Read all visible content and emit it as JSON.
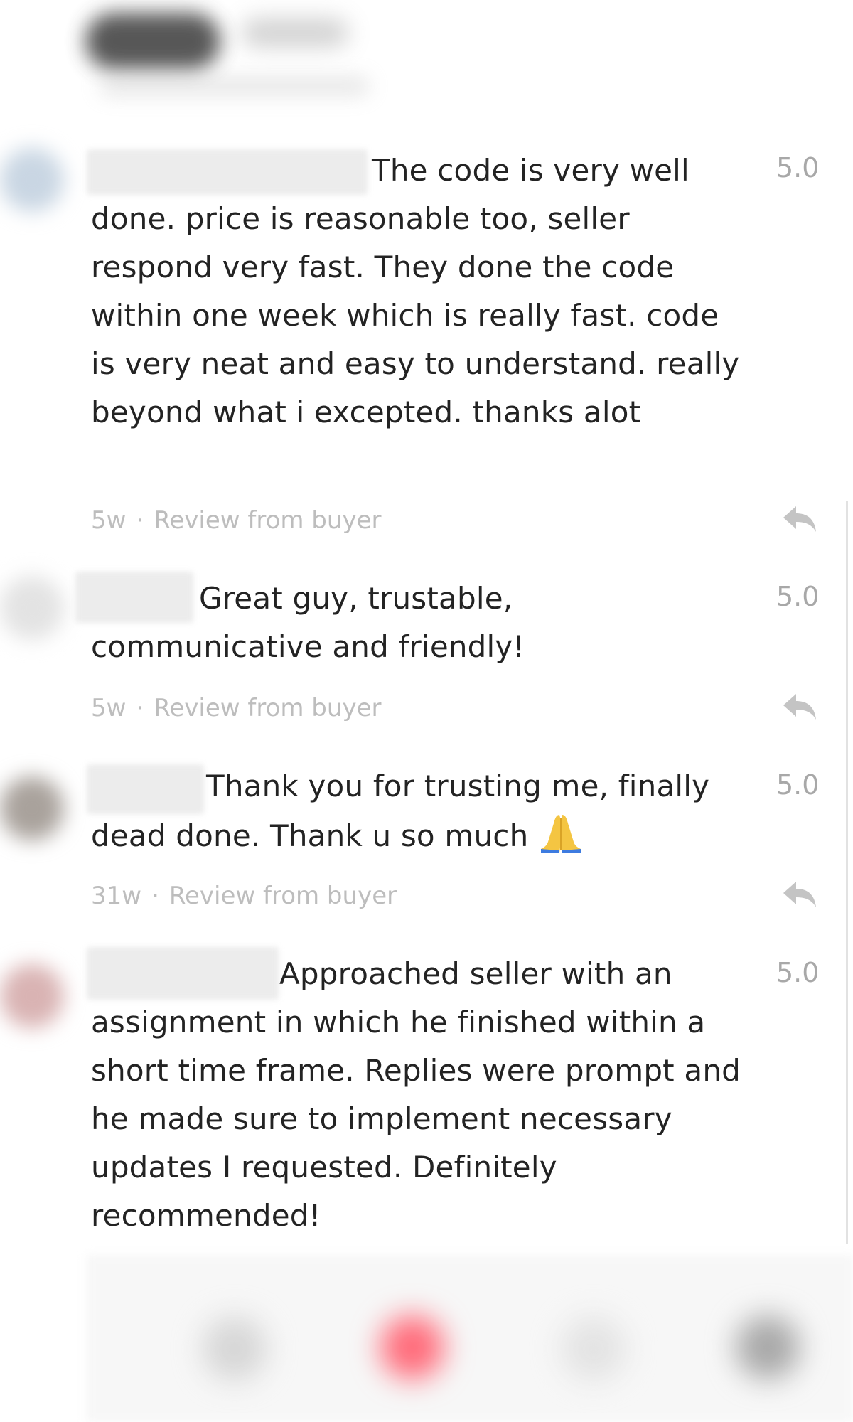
{
  "header": {
    "title": "",
    "subtitle": ""
  },
  "reviews": [
    {
      "text": "The code is very well done. price is reasonable too,   seller respond very fast. They done the code within one week which is really fast. code is very neat and easy to understand. really beyond what i excepted. thanks alot",
      "rating": "5.0",
      "time": "5w",
      "source": "Review from buyer",
      "avatar_color": "#c9d6e3"
    },
    {
      "text": "Great guy, trustable, communicative and friendly!",
      "rating": "5.0",
      "time": "5w",
      "source": "Review from buyer",
      "avatar_color": "#e3e3e3"
    },
    {
      "text": "Thank you for trusting me, finally dead done. Thank u so much",
      "rating": "5.0",
      "time": "31w",
      "source": "Review from buyer",
      "avatar_color": "#a9a29c",
      "emoji": "folded-hands-icon"
    },
    {
      "text": "Approached seller with an assignment in which he finished within a short time frame. Replies were prompt and he made sure to implement necessary updates I requested. Definitely recommended!",
      "rating": "5.0",
      "time": "",
      "source": "",
      "avatar_color": "#d9b3b3"
    }
  ],
  "meta_separator": "·",
  "icons": {
    "reply": "reply-icon",
    "emoji": "folded-hands-icon"
  },
  "colors": {
    "text": "#232323",
    "muted": "#bdbdbd",
    "rating": "#a8a8a8",
    "bottom_nav_accent": "#ff6b7a"
  },
  "bottom_nav": {
    "items": [
      "nav-home-icon",
      "nav-messages-icon",
      "nav-orders-icon",
      "nav-profile-icon"
    ]
  }
}
